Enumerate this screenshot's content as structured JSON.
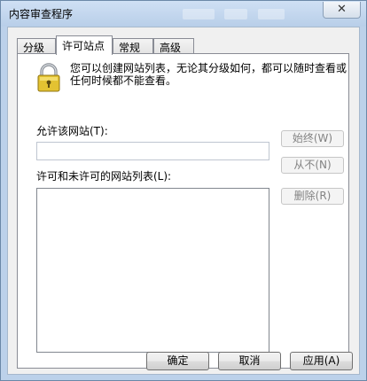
{
  "window": {
    "title": "内容审查程序",
    "close_glyph": "✕"
  },
  "tabs": [
    {
      "label": "分级"
    },
    {
      "label": "许可站点"
    },
    {
      "label": "常规"
    },
    {
      "label": "高级"
    }
  ],
  "active_tab": "许可站点",
  "panel": {
    "icon": "padlock-icon",
    "description": "您可以创建网站列表，无论其分级如何，都可以随时查看或任何时候都不能查看。",
    "allow_site_label": "允许该网站(T):",
    "allow_site_value": "",
    "list_label": "许可和未许可的网站列表(L):",
    "list_items": [],
    "buttons": {
      "always": "始终(W)",
      "never": "从不(N)",
      "remove": "删除(R)"
    }
  },
  "footer": {
    "ok": "确定",
    "cancel": "取消",
    "apply": "应用(A)"
  },
  "colors": {
    "titlebar": "#bcd1ea",
    "panel_bg": "#ffffff",
    "dialog_bg": "#f0f0f0",
    "disabled_text": "#838383"
  }
}
